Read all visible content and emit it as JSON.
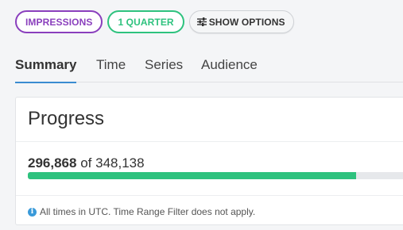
{
  "filters": {
    "metric_chip": "IMPRESSIONS",
    "range_chip": "1 QUARTER",
    "options_button": "SHOW OPTIONS",
    "options_icon": "sliders-icon",
    "colors": {
      "metric": "#8a3fbd",
      "range": "#2ec27e"
    }
  },
  "tabs": [
    {
      "label": "Summary",
      "active": true
    },
    {
      "label": "Time",
      "active": false
    },
    {
      "label": "Series",
      "active": false
    },
    {
      "label": "Audience",
      "active": false
    }
  ],
  "progress_card": {
    "title": "Progress",
    "current": "296,868",
    "separator": "of",
    "total": "348,138",
    "fraction": 0.853,
    "bar_color": "#2ec27e",
    "note_icon": "info-icon",
    "note": "All times in UTC. Time Range Filter does not apply."
  },
  "accent_color": "#3a8bd1"
}
